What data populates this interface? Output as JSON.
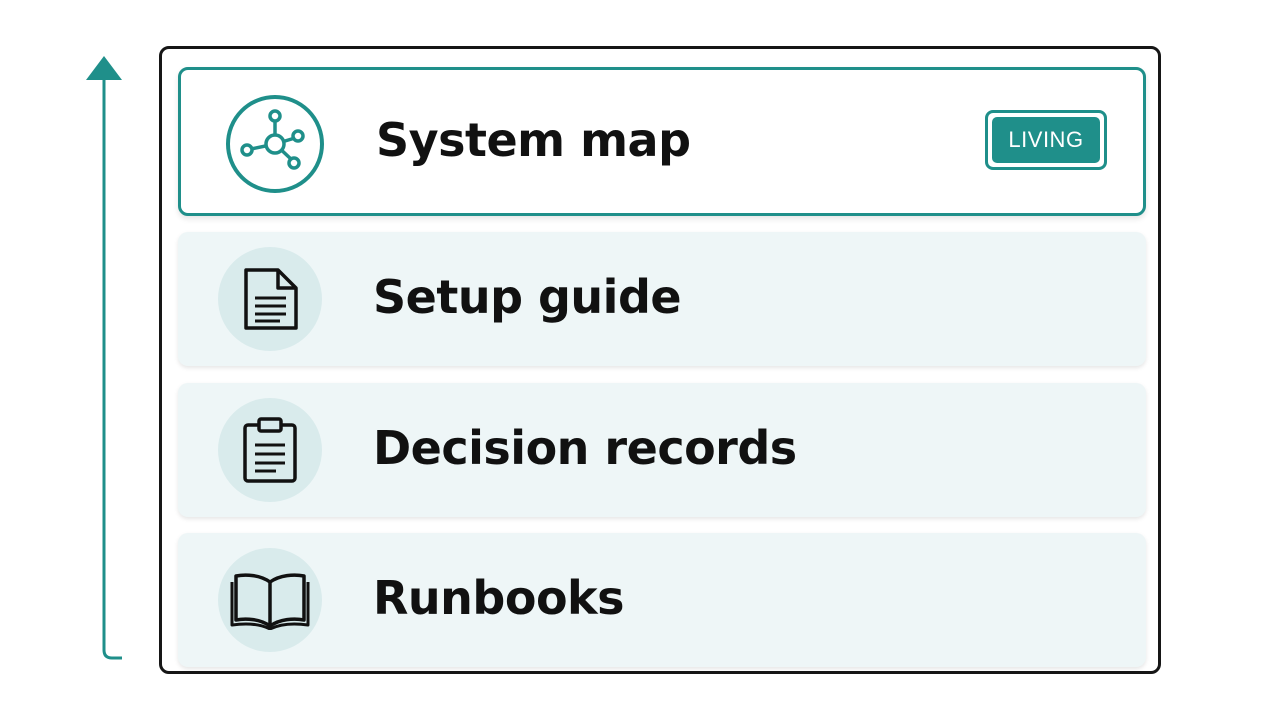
{
  "colors": {
    "accent": "#1f8f8a",
    "panel_border": "#161616",
    "card_fill": "#eef6f7",
    "icon_circle": "#d9ebec",
    "text": "#111111"
  },
  "axis": {
    "direction": "up",
    "icon": "arrow-up-icon"
  },
  "items": [
    {
      "label": "System map",
      "icon": "network-icon",
      "badge": "LIVING",
      "highlighted": true
    },
    {
      "label": "Setup guide",
      "icon": "document-icon",
      "highlighted": false
    },
    {
      "label": "Decision records",
      "icon": "clipboard-icon",
      "highlighted": false
    },
    {
      "label": "Runbooks",
      "icon": "book-icon",
      "highlighted": false
    }
  ]
}
